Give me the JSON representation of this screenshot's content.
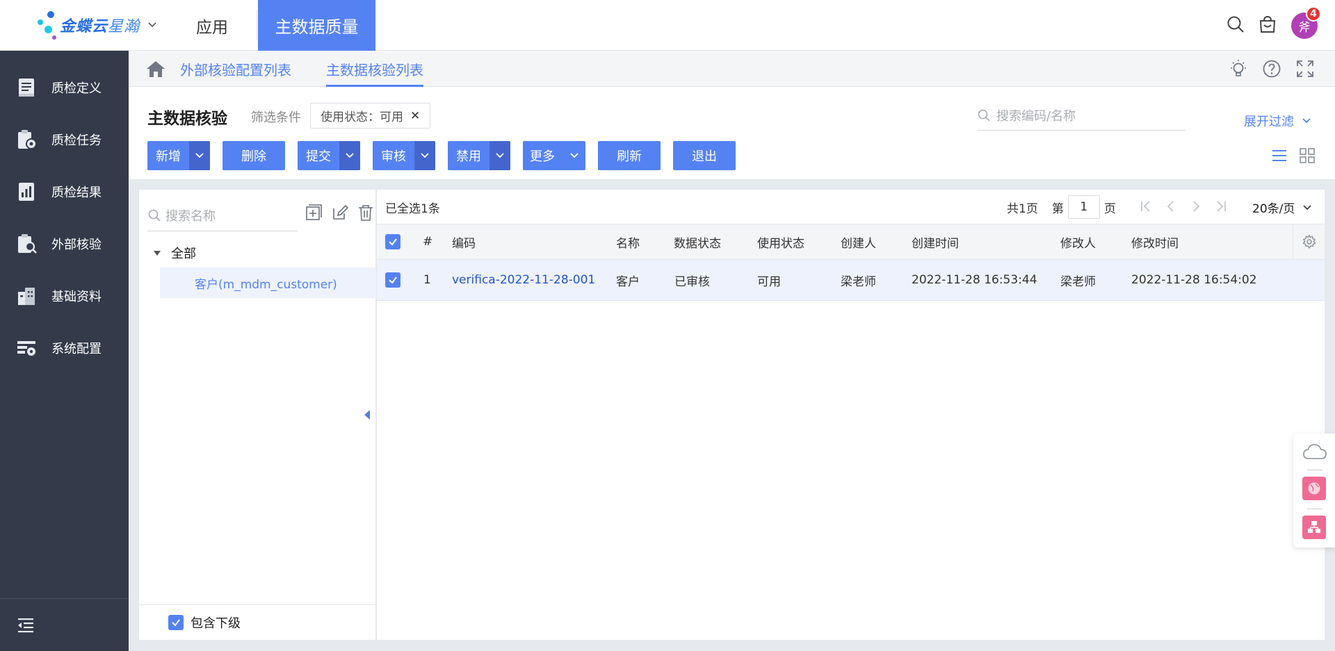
{
  "topbar": {
    "logo_main": "金蝶云",
    "logo_sub": "星瀚",
    "app_label": "应用",
    "active_app": "主数据质量",
    "avatar_text": "斧",
    "notification_count": "4",
    "icons": [
      "search-icon",
      "bag-icon"
    ]
  },
  "sidebar": {
    "items": [
      {
        "label": "质检定义",
        "icon": "book-icon"
      },
      {
        "label": "质检任务",
        "icon": "clipboard-gear-icon"
      },
      {
        "label": "质检结果",
        "icon": "report-icon"
      },
      {
        "label": "外部核验",
        "icon": "clipboard-search-icon"
      },
      {
        "label": "基础资料",
        "icon": "building-icon"
      },
      {
        "label": "系统配置",
        "icon": "settings-panel-icon"
      }
    ],
    "collapse_icon": "collapse-menu-icon"
  },
  "tabs": [
    {
      "label": "外部核验配置列表",
      "active": false
    },
    {
      "label": "主数据核验列表",
      "active": true
    }
  ],
  "tabbar_icons": [
    "home-icon",
    "lightbulb-icon",
    "help-icon",
    "fullscreen-icon"
  ],
  "header": {
    "title": "主数据核验",
    "filter_label": "筛选条件",
    "filter_chip": "使用状态：可用",
    "search_placeholder": "搜索编码/名称",
    "expand_filter": "展开过滤"
  },
  "toolbar": {
    "add": "新增",
    "delete": "删除",
    "submit": "提交",
    "audit": "审核",
    "disable": "禁用",
    "more": "更多",
    "refresh": "刷新",
    "exit": "退出"
  },
  "tree": {
    "search_placeholder": "搜索名称",
    "root_label": "全部",
    "node_label": "客户(m_mdm_customer)",
    "include_sub": "包含下级"
  },
  "grid": {
    "selection_info": "已全选1条",
    "total_pages": "共1页",
    "page_prefix": "第",
    "page_value": "1",
    "page_suffix": "页",
    "page_size": "20条/页",
    "columns": {
      "index": "#",
      "code": "编码",
      "name": "名称",
      "data_status": "数据状态",
      "use_status": "使用状态",
      "creator": "创建人",
      "create_time": "创建时间",
      "modifier": "修改人",
      "modify_time": "修改时间"
    },
    "rows": [
      {
        "index": "1",
        "code": "verifica-2022-11-28-001",
        "name": "客户",
        "data_status": "已审核",
        "use_status": "可用",
        "creator": "梁老师",
        "create_time": "2022-11-28 16:53:44",
        "modifier": "梁老师",
        "modify_time": "2022-11-28 16:54:02"
      }
    ]
  },
  "colors": {
    "accent": "#5582f3",
    "sidebar_bg": "#343a4a",
    "badge": "#e8322f",
    "avatar": "#b23fb5"
  }
}
